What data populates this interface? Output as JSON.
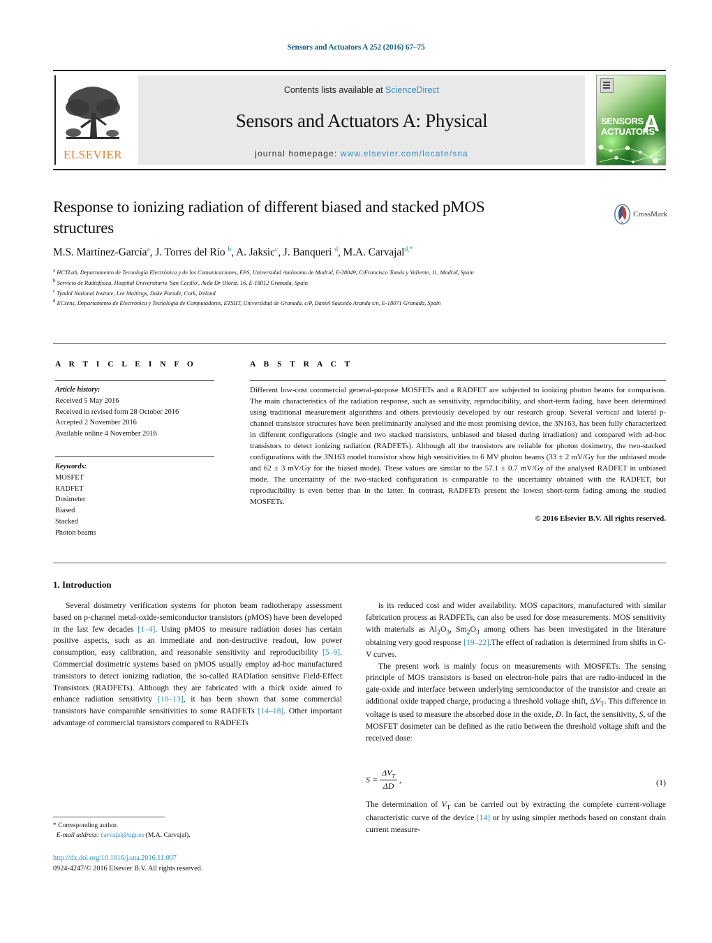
{
  "running_head": "Sensors and Actuators A 252 (2016) 67–75",
  "masthead": {
    "contents_prefix": "Contents lists available at ",
    "contents_link": "ScienceDirect",
    "journal_title": "Sensors and Actuators A: Physical",
    "homepage_prefix": "journal homepage: ",
    "homepage_url": "www.elsevier.com/locate/sna",
    "publisher": "ELSEVIER",
    "cover": {
      "line1": "SENSORS",
      "line1_small": "and",
      "line2": "ACTUATORS",
      "letter": "A"
    }
  },
  "article": {
    "title": "Response to ionizing radiation of different biased and stacked pMOS structures",
    "crossmark_label": "CrossMark",
    "authors_html": "M.S. Martínez-García<sup>a</sup>, J. Torres del Río <sup>b</sup>, A. Jaksic<sup>c</sup>, J. Banqueri <sup>d</sup>, M.A. Carvajal<sup>d,*</sup>",
    "affiliations": [
      "HCTLab, Departamento de Tecnología Electrónica y de las Comunicaciones, EPS, Universidad Autónoma de Madrid, E-28049, C/Francisco Tomás y Valiente, 11, Madrid, Spain",
      "Servicio de Radiofísica, Hospital Universitario 'San Cecilio', Avda Dr Olóriz, 16, E-18012 Granada, Spain",
      "Tyndal National Insitute, Lee Maltings, Duke Parade, Cork, Ireland",
      "ECsens, Departamento de Electrónica y Tecnología de Computadores, ETSIIT, Universidad de Granada, c/P, Daniel Saucedo Aranda s/n, E-18071 Granada, Spain"
    ],
    "affiliation_marks": [
      "a",
      "b",
      "c",
      "d"
    ]
  },
  "info": {
    "heading": "A R T I C L E   I N F O",
    "history_label": "Article history:",
    "history": [
      "Received 5 May 2016",
      "Received in revised form 28 October 2016",
      "Accepted 2 November 2016",
      "Available online 4 November 2016"
    ],
    "keywords_label": "Keywords:",
    "keywords": [
      "MOSFET",
      "RADFET",
      "Dosimeter",
      "Biased",
      "Stacked",
      "Photon beams"
    ]
  },
  "abstract": {
    "heading": "A B S T R A C T",
    "text": "Different low-cost commercial general-purpose MOSFETs and a RADFET are subjected to ionizing photon beams for comparison. The main characteristics of the radiation response, such as sensitivity, reproducibility, and short-term fading, have been determined using traditional measurement algorithms and others previously developed by our research group. Several vertical and lateral p-channel transistor structures have been preliminarily analysed and the most promising device, the 3N163, has been fully characterized in different configurations (single and two stacked transistors, unbiased and biased during irradiation) and compared with ad-hoc transistors to detect ionizing radiation (RADFETs). Although all the transistors are reliable for photon dosimetry, the two-stacked configurations with the 3N163 model transistor show high sensitivities to 6 MV photon beams (33 ± 2 mV/Gy for the unbiased mode and 62 ± 3 mV/Gy for the biased mode). These values are similar to the 57.1 ± 0.7 mV/Gy of the analysed RADFET in unbiased mode. The uncertainty of the two-stacked configuration is comparable to the uncertainty obtained with the RADFET, but reproducibility is even better than in the latter. In contrast, RADFETs present the lowest short-term fading among the studied MOSFETs.",
    "copyright": "© 2016 Elsevier B.V. All rights reserved."
  },
  "body": {
    "section_title": "1.  Introduction",
    "left_paragraph_1_html": "Several dosimetry verification systems for photon beam radiotherapy assessment based on p-channel metal-oxide-semiconductor transistors (pMOS) have been developed in the last few decades <span class=\"ref\">[1–4]</span>. Using pMOS to measure radiation doses has certain positive aspects, such as an immediate and non-destructive readout, low power consumption, easy calibration, and reasonable sensitivity and reproducibility <span class=\"ref\">[5–9]</span>. Commercial dosimetric systems based on pMOS usually employ ad-hoc manufactured transistors to detect ionizing radiation, the so-called RADIation sensitive Field-Effect Transistors (RADFETs). Although they are fabricated with a thick oxide aimed to enhance radiation sensitivity <span class=\"ref\">[10–13]</span>, it has been shown that some commercial transistors have comparable sensitivities to some RADFETs <span class=\"ref\">[14–18]</span>. Other important advantage of commercial transistors compared to RADFETs",
    "right_paragraph_1_html": "is its reduced cost and wider availability. MOS capacitors, manufactured with similar fabrication process as RADFETs, can also be used for dose measurements. MOS sensitivity with materials as Al<sub>2</sub>O<sub>3</sub>, Sm<sub>2</sub>O<sub>3</sub> among others has been investigated in the literature obtaining very good response <span class=\"ref\">[19–22]</span>.The effect of radiation is determined from shifts in C-V curves.",
    "right_paragraph_2_html": "The present work is mainly focus on measurements with MOSFETs. The sensing principle of MOS transistors is based on electron-hole pairs that are radio-induced in the gate-oxide and interface between underlying semiconductor of the transistor and create an additional oxide trapped charge, producing a threshold voltage shift, &Delta;<i>V</i><sub>T</sub>. This difference in voltage is used to measure the absorbed dose in the oxide, <i>D</i>. In fact, the sensitivity, <i>S</i>, of the MOSFET dosimeter can be defined as the ratio between the threshold voltage shift and the received dose:",
    "equation": {
      "lhs": "S =",
      "numerator": "ΔV",
      "numerator_sub": "T",
      "denominator": "ΔD",
      "trailing": ",",
      "number": "(1)"
    },
    "right_paragraph_3_html": "The determination of <i>V</i><sub>T</sub> can be carried out by extracting the complete current-voltage characteristic curve of the device <span class=\"ref\">[14]</span> or by using simpler methods based on constant drain current measure-"
  },
  "footnotes": {
    "corresponding": "* Corresponding author.",
    "email_label": "E-mail address:",
    "email": "carvajal@ugr.es",
    "email_suffix": "(M.A. Carvajal).",
    "doi": "http://dx.doi.org/10.1016/j.sna.2016.11.007",
    "issn_line": "0924-4247/© 2016 Elsevier B.V. All rights reserved."
  },
  "colors": {
    "link": "#2b8fc9",
    "heading_blue": "#1a5f8a",
    "elsevier_orange": "#e8802a",
    "band_gray": "#e9e9e9"
  }
}
